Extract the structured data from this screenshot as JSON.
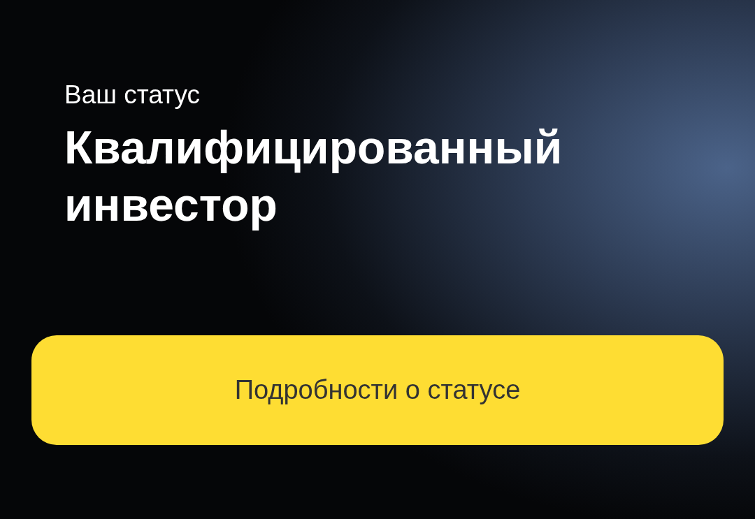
{
  "status_label": "Ваш статус",
  "status_title": "Квалифицированный инвестор",
  "details_button": {
    "label": "Подробности о статусе"
  }
}
